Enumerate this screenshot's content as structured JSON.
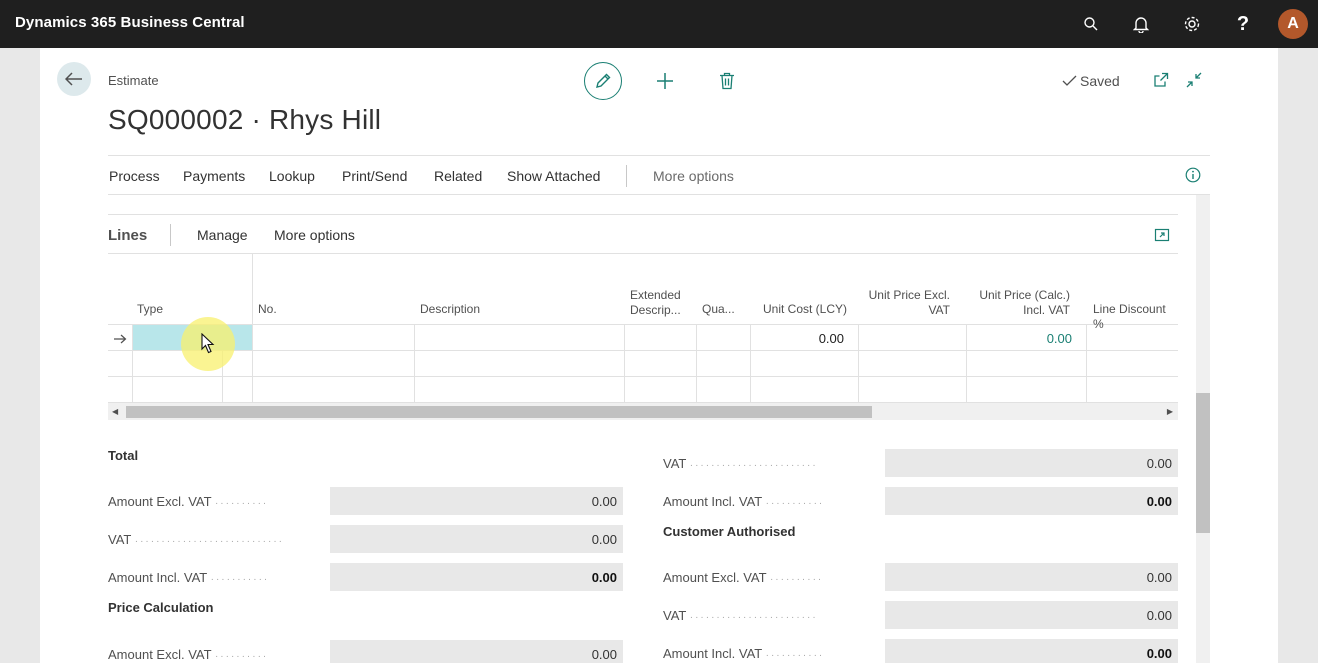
{
  "app": {
    "title": "Dynamics 365 Business Central",
    "avatar_letter": "A"
  },
  "header": {
    "caption": "Estimate",
    "title": "SQ000002 · Rhys Hill",
    "saved_label": "Saved"
  },
  "actions": {
    "items": [
      "Process",
      "Payments",
      "Lookup",
      "Print/Send",
      "Related",
      "Show Attached"
    ],
    "more": "More options"
  },
  "lines": {
    "title": "Lines",
    "manage": "Manage",
    "more": "More options",
    "columns": {
      "type": "Type",
      "no": "No.",
      "description": "Description",
      "ext1": "Extended",
      "ext2": "Descrip...",
      "qty": "Qua...",
      "unit_cost": "Unit Cost (LCY)",
      "upe1": "Unit Price Excl.",
      "upe2": "VAT",
      "upc1": "Unit Price (Calc.)",
      "upc2": "Incl. VAT",
      "discount": "Line Discount %"
    },
    "row1": {
      "unit_cost": "0.00",
      "unit_price_calc": "0.00"
    }
  },
  "totals": {
    "total_title": "Total",
    "price_calc_title": "Price Calculation",
    "customer_auth_title": "Customer Authorised",
    "amount_excl_label": "Amount Excl. VAT",
    "vat_label": "VAT",
    "amount_incl_label": "Amount Incl. VAT",
    "total": {
      "amount_excl": "0.00",
      "vat": "0.00",
      "amount_incl": "0.00"
    },
    "price_calc": {
      "amount_excl": "0.00"
    },
    "right_top": {
      "vat": "0.00",
      "amount_incl": "0.00"
    },
    "customer_auth": {
      "amount_excl": "0.00",
      "vat": "0.00",
      "amount_incl": "0.00"
    }
  },
  "colors": {
    "accent": "#1a7f73",
    "topbar": "#1f1f1f",
    "avatar": "#b3582b",
    "selected_cell": "#b8e6ea"
  }
}
